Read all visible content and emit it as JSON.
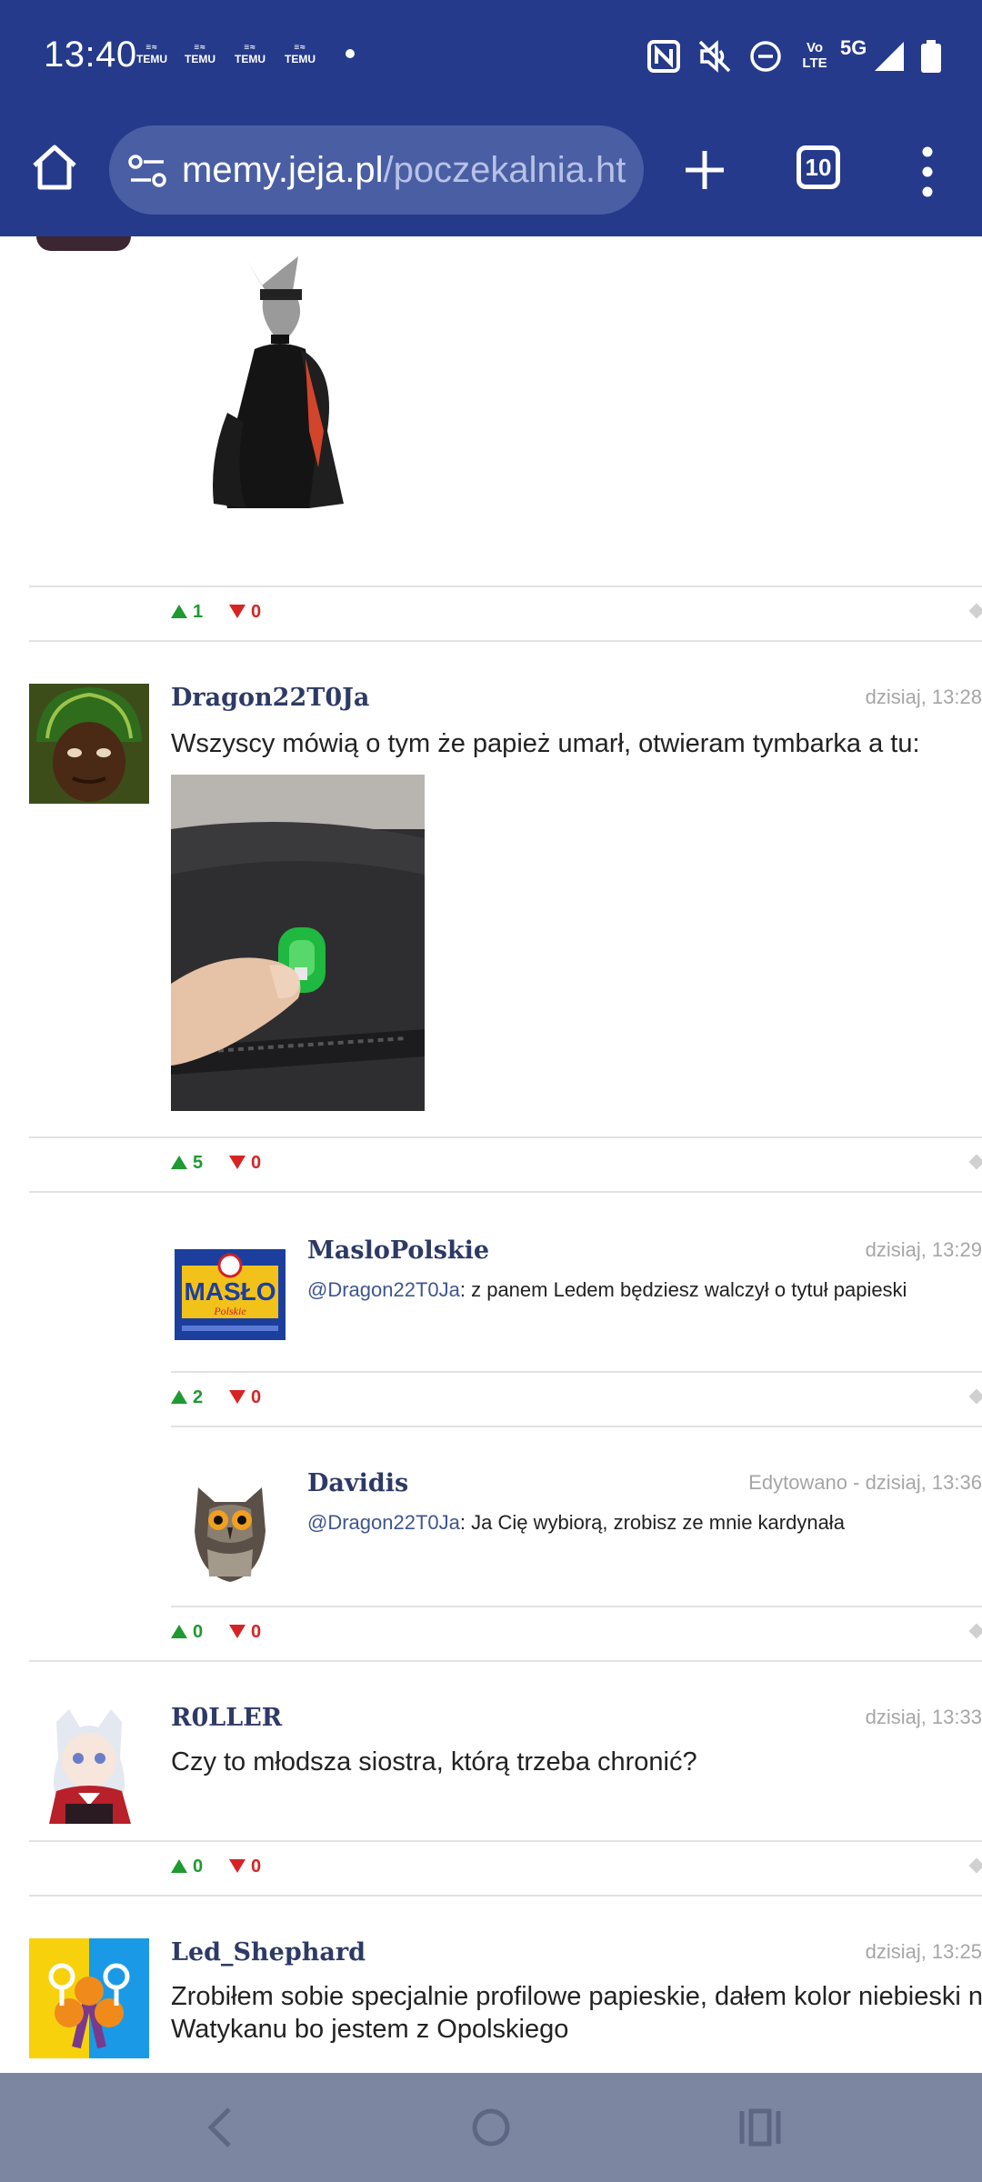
{
  "status_bar": {
    "time": "13:40",
    "notification_icons": [
      "temu-icon",
      "temu-icon",
      "temu-icon",
      "temu-icon"
    ],
    "temu_label": "TEMU",
    "network": "5G",
    "volte": "Vo LTE"
  },
  "browser": {
    "url_domain": "memy.jeja.pl",
    "url_path": "/poczekalnia.ht",
    "tab_count": "10"
  },
  "comments": [
    {
      "id": "top-partial",
      "upvotes": "1",
      "downvotes": "0"
    },
    {
      "id": "dragon",
      "username": "Dragon22T0Ja",
      "time": "dzisiaj, 13:28",
      "text": "Wszyscy mówią o tym że papież umarł, otwieram tymbarka a tu:",
      "upvotes": "5",
      "downvotes": "0"
    },
    {
      "id": "maslo",
      "username": "MasloPolskie",
      "time": "dzisiaj, 13:29",
      "mention": "@Dragon22T0Ja",
      "text": ": z panem Ledem będziesz walczył o tytuł papieski",
      "upvotes": "2",
      "downvotes": "0"
    },
    {
      "id": "davidis",
      "username": "Davidis",
      "time": "Edytowano - dzisiaj, 13:36",
      "mention": "@Dragon22T0Ja",
      "text": ": Ja Cię wybiorą, zrobisz ze mnie kardynała",
      "upvotes": "0",
      "downvotes": "0"
    },
    {
      "id": "roller",
      "username": "R0LLER",
      "time": "dzisiaj, 13:33",
      "text": "Czy to młodsza siostra, którą trzeba chronić?",
      "upvotes": "0",
      "downvotes": "0"
    },
    {
      "id": "led",
      "username": "Led_Shephard",
      "time": "dzisiaj, 13:25",
      "text_line1": "Zrobiłem sobie specjalnie profilowe papieskie, dałem kolor niebieski na fla",
      "text_line2": "Watykanu bo jestem z Opolskiego"
    }
  ],
  "avatar_labels": {
    "maslo_brand": "MASŁO",
    "maslo_sub": "Polskie"
  }
}
